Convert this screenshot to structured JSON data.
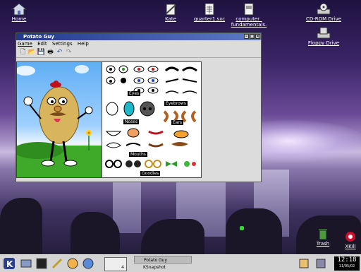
{
  "desktop_icons": [
    {
      "id": "home",
      "label": "Home"
    },
    {
      "id": "kate",
      "label": "Kate"
    },
    {
      "id": "quarter",
      "label": "quarter1.sxc"
    },
    {
      "id": "computer",
      "label": "computer_ fundamentals."
    },
    {
      "id": "cdrom",
      "label": "CD-ROM Drive"
    },
    {
      "id": "floppy",
      "label": "Floppy Drive"
    },
    {
      "id": "trash",
      "label": "Trash"
    },
    {
      "id": "xkill",
      "label": "XKill"
    }
  ],
  "window": {
    "title": "Potato Guy",
    "menu": [
      "Game",
      "Edit",
      "Settings",
      "Help"
    ],
    "toolbar": [
      "new-icon",
      "open-icon",
      "save-icon",
      "print-icon",
      "undo-icon",
      "redo-icon"
    ],
    "categories": [
      "Eyes",
      "Eyebrows",
      "Noses",
      "Ears",
      "Mouths",
      "Goodies"
    ]
  },
  "taskbar": {
    "desk_number": "4",
    "tasks": [
      "Potato Guy",
      "KSnapshot"
    ],
    "clock_time": "12:18",
    "clock_date": "11/05/02"
  },
  "colors": {
    "title_start": "#223a8c",
    "title_end": "#5c7ac8",
    "taskbar": "#d4d4d4"
  }
}
